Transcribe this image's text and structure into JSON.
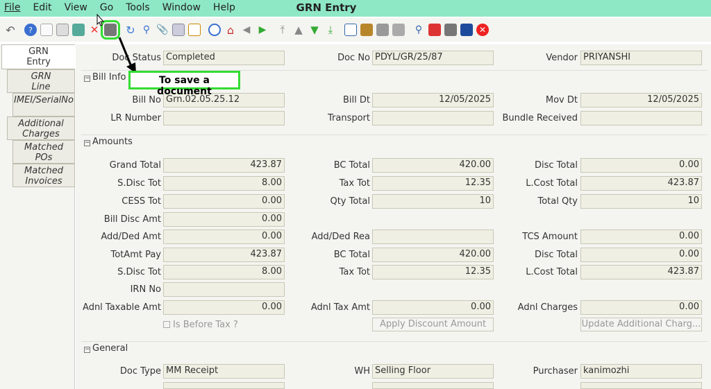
{
  "menu": {
    "file": "File",
    "edit": "Edit",
    "view": "View",
    "go": "Go",
    "tools": "Tools",
    "window": "Window",
    "help": "Help"
  },
  "title": "GRN Entry",
  "annotation": "To save a document",
  "tabs": [
    "GRN Entry",
    "GRN Line",
    "IMEI/SerialNo",
    "Additional Charges",
    "Matched POs",
    "Matched Invoices"
  ],
  "tab_lines": [
    [
      "GRN",
      "Entry"
    ],
    [
      "GRN",
      "Line"
    ],
    [
      "IMEI/SerialNo"
    ],
    [
      "Additional",
      "Charges"
    ],
    [
      "Matched",
      "POs"
    ],
    [
      "Matched",
      "Invoices"
    ]
  ],
  "header": {
    "doc_status_label": "Doc Status",
    "doc_status": "Completed",
    "doc_no_label": "Doc No",
    "doc_no": "PDYL/GR/25/87",
    "vendor_label": "Vendor",
    "vendor": "PRIYANSHI"
  },
  "sections": {
    "bill": "Bill Info",
    "amounts": "Amounts",
    "general": "General"
  },
  "bill": {
    "bill_no_label": "Bill No",
    "bill_no": "Grn.02.05.25.12",
    "bill_dt_label": "Bill Dt",
    "bill_dt": "12/05/2025",
    "mov_dt_label": "Mov Dt",
    "mov_dt": "12/05/2025",
    "lr_number_label": "LR Number",
    "lr_number": "",
    "transport_label": "Transport",
    "transport": "",
    "bundle_label": "Bundle Received",
    "bundle": ""
  },
  "amounts": {
    "grand_total_label": "Grand Total",
    "grand_total": "423.87",
    "bc_total_label": "BC Total",
    "bc_total": "420.00",
    "disc_total_label": "Disc Total",
    "disc_total": "0.00",
    "sdisc_tot_label": "S.Disc Tot",
    "sdisc_tot": "8.00",
    "tax_tot_label": "Tax Tot",
    "tax_tot": "12.35",
    "lcost_total_label": "L.Cost Total",
    "lcost_total": "423.87",
    "cess_tot_label": "CESS Tot",
    "cess_tot": "0.00",
    "qty_total_label": "Qty Total",
    "qty_total": "10",
    "total_qty_label": "Total Qty",
    "total_qty": "10",
    "bill_disc_amt_label": "Bill Disc Amt",
    "bill_disc_amt": "0.00",
    "add_ded_amt_label": "Add/Ded Amt",
    "add_ded_amt": "0.00",
    "add_ded_rea_label": "Add/Ded Rea",
    "add_ded_rea": "",
    "tcs_amount_label": "TCS Amount",
    "tcs_amount": "0.00",
    "totamt_pay_label": "TotAmt Pay",
    "totamt_pay": "423.87",
    "bc_total2_label": "BC Total",
    "bc_total2": "420.00",
    "disc_total2_label": "Disc Total",
    "disc_total2": "0.00",
    "sdisc_tot2_label": "S.Disc Tot",
    "sdisc_tot2": "8.00",
    "tax_tot2_label": "Tax Tot",
    "tax_tot2": "12.35",
    "lcost_total2_label": "L.Cost Total",
    "lcost_total2": "423.87",
    "irn_no_label": "IRN No",
    "irn_no": "",
    "adnl_taxable_label": "Adnl Taxable Amt",
    "adnl_taxable": "0.00",
    "adnl_tax_label": "Adnl Tax Amt",
    "adnl_tax": "0.00",
    "adnl_charges_label": "Adnl Charges",
    "adnl_charges": "0.00",
    "is_before_tax": "Is Before Tax ?",
    "apply_discount": "Apply Discount Amount",
    "update_additional": "Update Additional Charg..."
  },
  "general": {
    "doc_type_label": "Doc Type",
    "doc_type": "MM Receipt",
    "wh_label": "WH",
    "wh": "Selling Floor",
    "purchaser_label": "Purchaser",
    "purchaser": "kanimozhi"
  }
}
